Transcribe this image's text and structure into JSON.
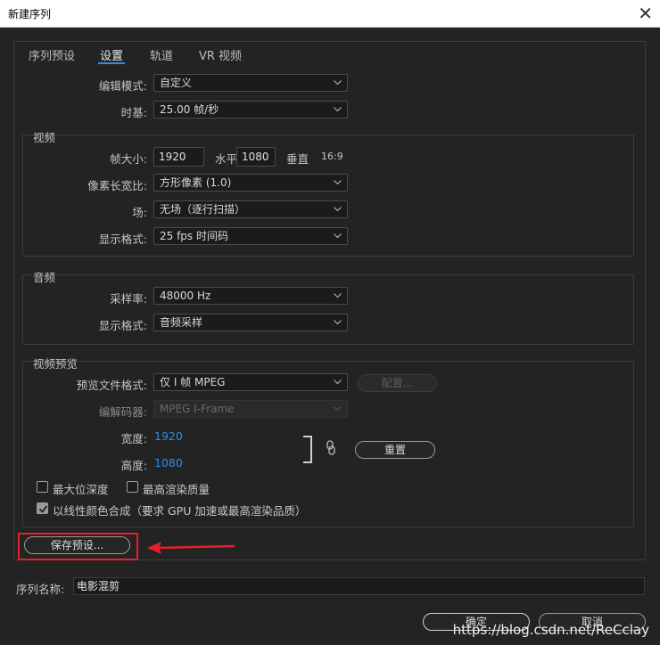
{
  "window": {
    "title": "新建序列"
  },
  "tabs": [
    {
      "label": "序列预设"
    },
    {
      "label": "设置"
    },
    {
      "label": "轨道"
    },
    {
      "label": "VR 视频"
    }
  ],
  "settings": {
    "editing_mode": {
      "label": "编辑模式:",
      "value": "自定义"
    },
    "timebase": {
      "label": "时基:",
      "value": "25.00  帧/秒"
    }
  },
  "video": {
    "legend": "视频",
    "frame_size": {
      "label": "帧大小:",
      "width": "1920",
      "width_unit": "水平",
      "height": "1080",
      "height_unit": "垂直",
      "ratio": "16:9"
    },
    "pixel_aspect": {
      "label": "像素长宽比:",
      "value": "方形像素 (1.0)"
    },
    "field": {
      "label": "场:",
      "value": "无场（逐行扫描）"
    },
    "display_format": {
      "label": "显示格式:",
      "value": "25 fps 时间码"
    }
  },
  "audio": {
    "legend": "音频",
    "sample_rate": {
      "label": "采样率:",
      "value": "48000 Hz"
    },
    "display_format": {
      "label": "显示格式:",
      "value": "音频采样"
    }
  },
  "preview": {
    "legend": "视频预览",
    "file_format": {
      "label": "预览文件格式:",
      "value": "仅 I 帧 MPEG"
    },
    "configure_label": "配置...",
    "codec": {
      "label": "编解码器:",
      "value": "MPEG I-Frame"
    },
    "width": {
      "label": "宽度:",
      "value": "1920"
    },
    "height": {
      "label": "高度:",
      "value": "1080"
    },
    "reset_label": "重置",
    "max_bit_depth": "最大位深度",
    "max_render_quality": "最高渲染质量",
    "linear_color": "以线性颜色合成（要求 GPU 加速或最高渲染品质）"
  },
  "save_preset_label": "保存预设...",
  "sequence_name": {
    "label": "序列名称:",
    "value": "电影混剪"
  },
  "buttons": {
    "ok": "确定",
    "cancel": "取消"
  },
  "watermark": "https://blog.csdn.net/ReCclay",
  "colors": {
    "accent": "#2d8ceb",
    "highlight_box": "#e5202a",
    "arrow": "#e5202a"
  }
}
